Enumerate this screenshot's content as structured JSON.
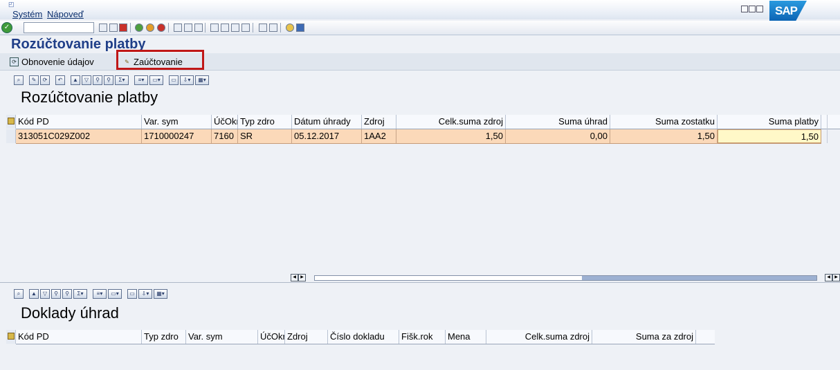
{
  "menubar": {
    "items": [
      "Systém",
      "Nápoveď"
    ],
    "brand": "SAP"
  },
  "page": {
    "title": "Rozúčtovanie platby"
  },
  "app_toolbar": {
    "refresh_label": "Obnovenie údajov",
    "post_label": "Zaúčtovanie"
  },
  "grid1": {
    "title": "Rozúčtovanie platby",
    "columns": [
      "Kód PD",
      "Var. sym",
      "ÚčOkr",
      "Typ zdro",
      "Dátum úhrady",
      "Zdroj",
      "Celk.suma zdroj",
      "Suma úhrad",
      "Suma zostatku",
      "Suma platby"
    ],
    "rows": [
      [
        "313051C029Z002",
        "1710000247",
        "7160",
        "SR",
        "05.12.2017",
        "1AA2",
        "1,50",
        "0,00",
        "1,50",
        "1,50"
      ]
    ]
  },
  "grid2": {
    "title": "Doklady úhrad",
    "columns": [
      "Kód PD",
      "Typ zdro",
      "Var. sym",
      "ÚčOkr",
      "Zdroj",
      "Číslo dokladu",
      "Fišk.rok",
      "Mena",
      "Celk.suma zdroj",
      "Suma za zdroj"
    ]
  },
  "colors": {
    "highlight": "#c01717",
    "row_bg": "#fbd9b9",
    "edit_bg": "#fff8c8",
    "title": "#1f3e88"
  },
  "icons": [
    "ok-icon",
    "save-icon",
    "back-icon",
    "exit-icon",
    "cancel-icon",
    "print-icon",
    "find-icon",
    "help-icon",
    "refresh-icon",
    "post-icon",
    "details-icon",
    "sort-ascending-icon",
    "filter-icon",
    "sum-icon",
    "export-icon",
    "layout-icon"
  ]
}
